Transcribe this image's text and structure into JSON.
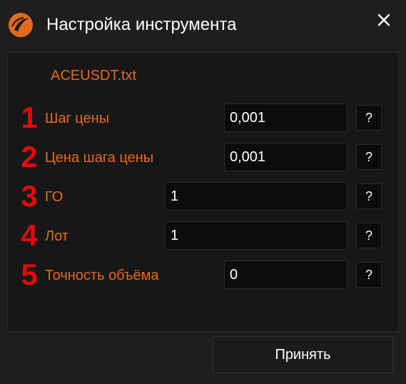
{
  "window": {
    "title": "Настройка инструмента",
    "logo_icon": "app-logo-icon",
    "close_icon": "close-icon"
  },
  "panel": {
    "file_name": "ACEUSDT.txt",
    "rows": [
      {
        "number": "1",
        "label": "Шаг цены",
        "value": "0,001",
        "help": "?"
      },
      {
        "number": "2",
        "label": "Цена шага цены",
        "value": "0,001",
        "help": "?"
      },
      {
        "number": "3",
        "label": "ГО",
        "value": "1",
        "help": "?"
      },
      {
        "number": "4",
        "label": "Лот",
        "value": "1",
        "help": "?"
      },
      {
        "number": "5",
        "label": "Точность объёма",
        "value": "0",
        "help": "?"
      }
    ]
  },
  "footer": {
    "accept_label": "Принять"
  },
  "colors": {
    "background": "#1e1e1e",
    "panel": "#171717",
    "label_accent": "#e36a1e",
    "annotation_number": "#e20a0a",
    "field_background": "#0c0c0c"
  }
}
